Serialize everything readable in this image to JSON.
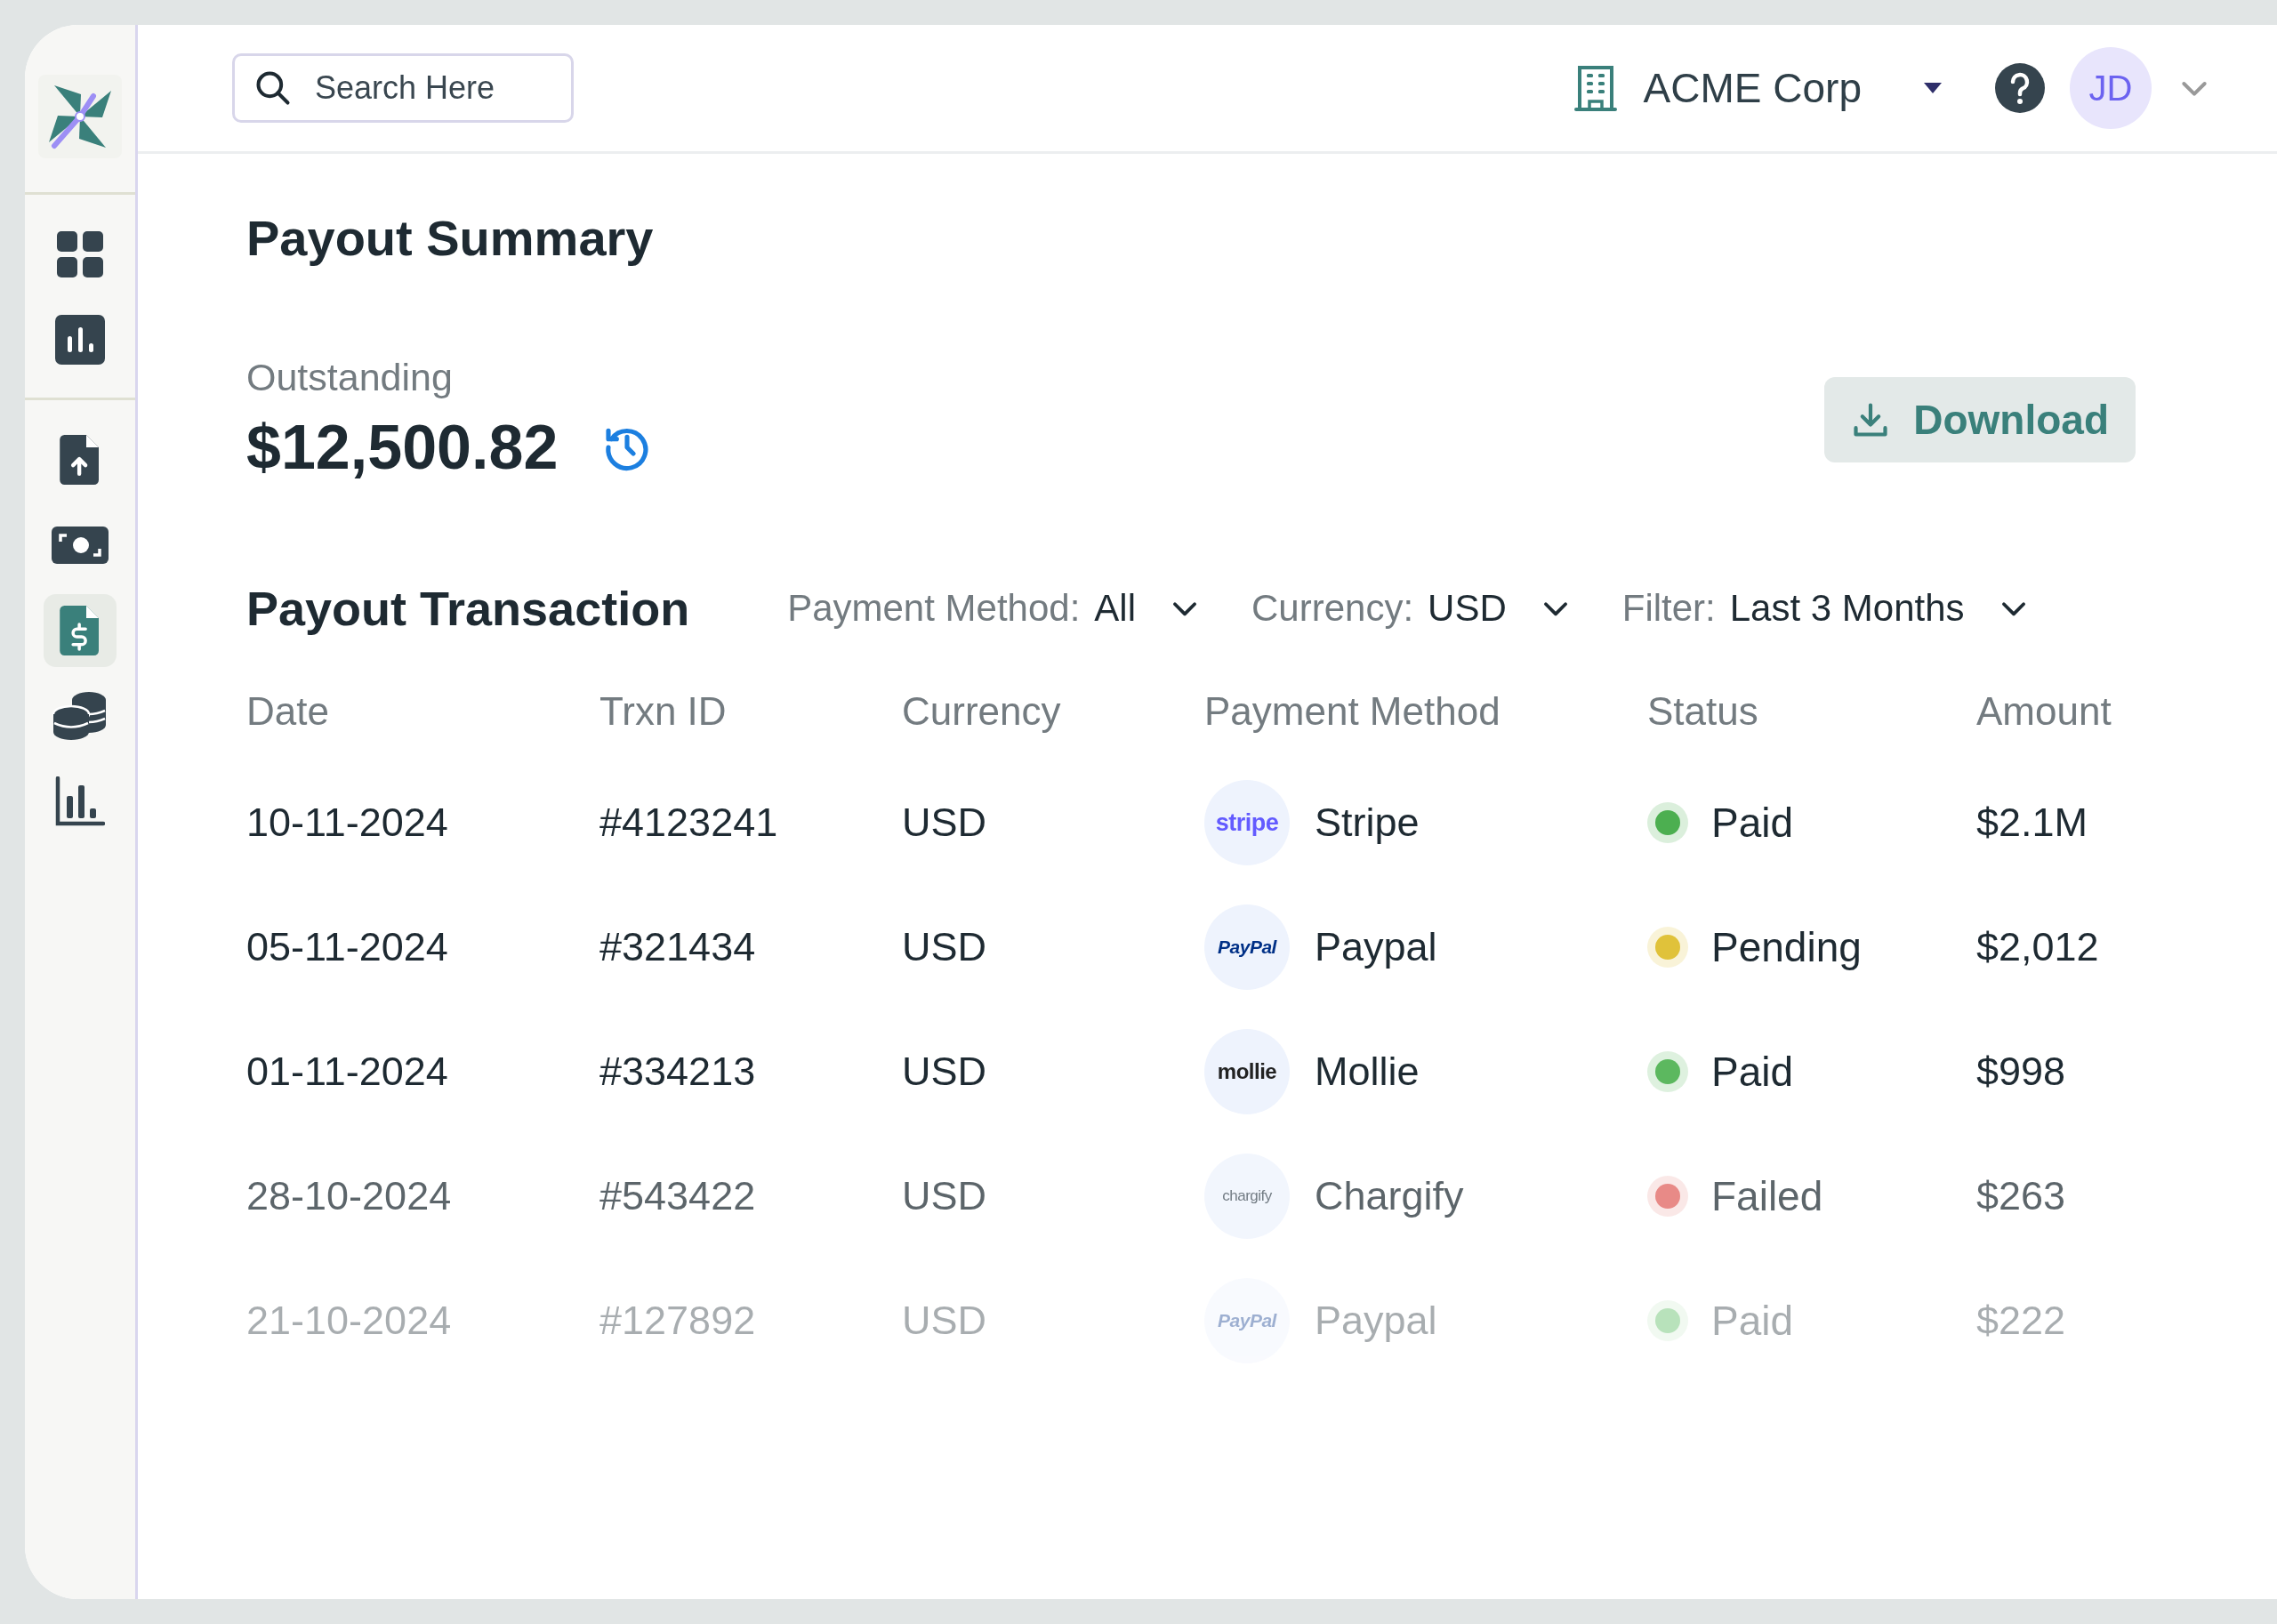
{
  "sidebar": {
    "items": [
      {
        "kind": "grid",
        "selected": false
      },
      {
        "kind": "chart-tile",
        "selected": false
      },
      {
        "kind": "upload-file",
        "selected": false
      },
      {
        "kind": "cash",
        "selected": false
      },
      {
        "kind": "invoice",
        "selected": true
      },
      {
        "kind": "coins",
        "selected": false
      },
      {
        "kind": "bar-chart",
        "selected": false
      }
    ]
  },
  "search": {
    "placeholder": "Search Here"
  },
  "header": {
    "company": "ACME Corp",
    "avatar_initials": "JD"
  },
  "summary": {
    "title": "Payout Summary",
    "outstanding_label": "Outstanding",
    "outstanding_amount": "$12,500.82",
    "download_button": "Download"
  },
  "transactions": {
    "title": "Payout Transaction",
    "filters": [
      {
        "label": "Payment Method:",
        "value": "All"
      },
      {
        "label": "Currency:",
        "value": "USD"
      },
      {
        "label": "Filter:",
        "value": "Last 3 Months"
      }
    ],
    "columns": [
      "Date",
      "Trxn ID",
      "Currency",
      "Payment Method",
      "Status",
      "Amount"
    ],
    "rows": [
      {
        "date": "10-11-2024",
        "trxn_id": "#4123241",
        "currency": "USD",
        "method_logo": "stripe",
        "kind": "stripe",
        "method": "Stripe",
        "status": "Paid",
        "color": "#4caf50",
        "amount": "$2.1M"
      },
      {
        "date": "05-11-2024",
        "trxn_id": "#321434",
        "currency": "USD",
        "method_logo": "PayPal",
        "kind": "paypal",
        "method": "Paypal",
        "status": "Pending",
        "color": "#e0c23a",
        "amount": "$2,012"
      },
      {
        "date": "01-11-2024",
        "trxn_id": "#334213",
        "currency": "USD",
        "method_logo": "mollie",
        "kind": "mollie",
        "method": "Mollie",
        "status": "Paid",
        "color": "#5cb85f",
        "amount": "$998"
      },
      {
        "date": "28-10-2024",
        "trxn_id": "#543422",
        "currency": "USD",
        "method_logo": "chargify",
        "kind": "chargify",
        "method": "Chargify",
        "status": "Failed",
        "color": "#e88a87",
        "amount": "$263"
      },
      {
        "date": "21-10-2024",
        "trxn_id": "#127892",
        "currency": "USD",
        "method_logo": "PayPal",
        "kind": "paypal",
        "method": "Paypal",
        "status": "Paid",
        "color": "#b8e2bb",
        "amount": "$222"
      }
    ]
  }
}
